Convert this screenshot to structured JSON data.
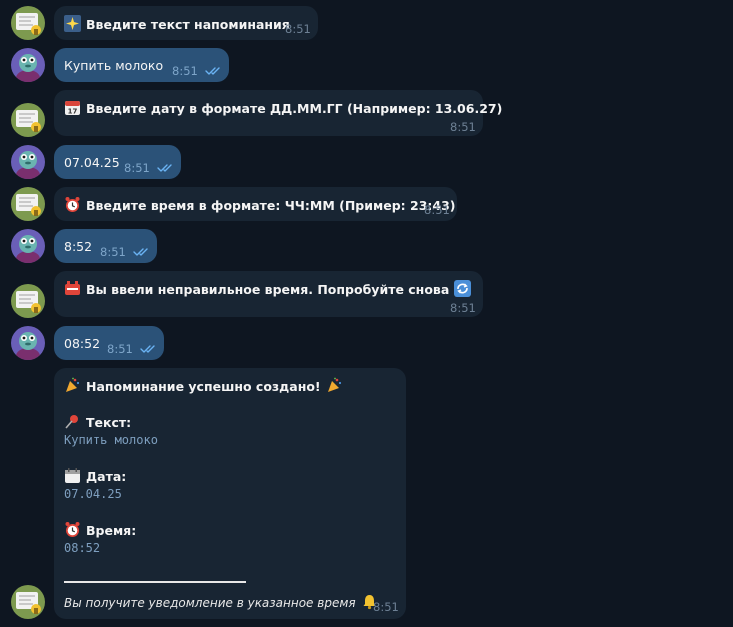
{
  "messages": [
    {
      "id": "m1",
      "side": "in",
      "emoji": "sparkle",
      "text": "Введите текст напоминания",
      "time": "8:51"
    },
    {
      "id": "m2",
      "side": "out",
      "text": "Купить молоко",
      "time": "8:51"
    },
    {
      "id": "m3",
      "side": "in",
      "emoji": "calendar",
      "text": "Введите дату в формате ДД.ММ.ГГ (Например: 13.06.27)",
      "time": "8:51"
    },
    {
      "id": "m4",
      "side": "out",
      "text": "07.04.25",
      "time": "8:51"
    },
    {
      "id": "m5",
      "side": "in",
      "emoji": "alarm-clock",
      "text": "Введите время в формате: ЧЧ:ММ (Пример: 23:43)",
      "time": "8:51"
    },
    {
      "id": "m6",
      "side": "out",
      "text": "8:52",
      "time": "8:51"
    },
    {
      "id": "m7",
      "side": "in",
      "emoji": "error-badge",
      "text": "Вы ввели неправильное время. Попробуйте снова",
      "emoji_after": "repeat",
      "time": "8:51"
    },
    {
      "id": "m8",
      "side": "out",
      "text": "08:52",
      "time": "8:51"
    }
  ],
  "summary": {
    "title": "Напоминание успешно создано!",
    "text_label": "Текст:",
    "text_value": "Купить молоко",
    "date_label": "Дата:",
    "date_value": "07.04.25",
    "time_label": "Время:",
    "time_value": "08:52",
    "footer": "Вы получите уведомление в указанное время",
    "time": "8:51"
  },
  "colors": {
    "background": "#0e1621",
    "incoming_bubble": "#182533",
    "outgoing_bubble": "#2b5278",
    "read_check": "#6ab3f3"
  }
}
